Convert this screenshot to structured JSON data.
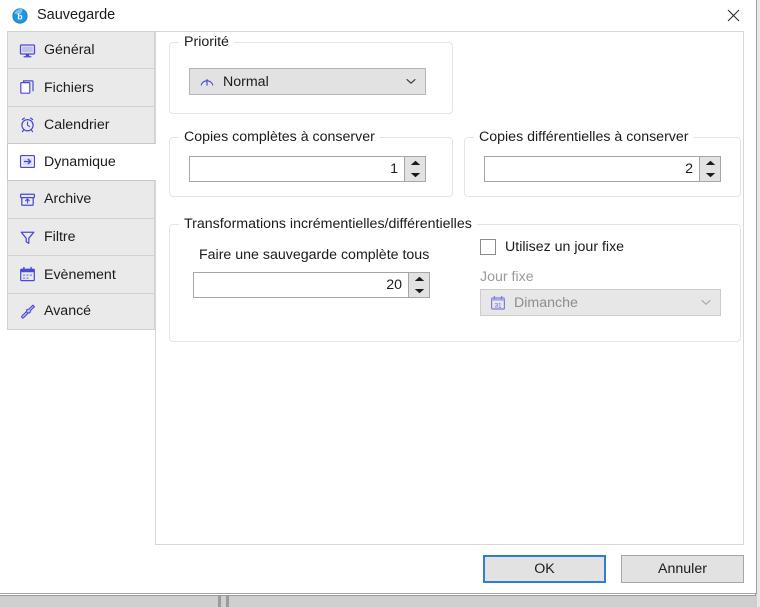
{
  "window": {
    "title": "Sauvegarde",
    "icon": "backup-disc-icon",
    "close_label": "×"
  },
  "sidebar": {
    "items": [
      {
        "label": "Général",
        "icon": "monitor-icon",
        "selected": false
      },
      {
        "label": "Fichiers",
        "icon": "files-icon",
        "selected": false
      },
      {
        "label": "Calendrier",
        "icon": "alarm-clock-icon",
        "selected": false
      },
      {
        "label": "Dynamique",
        "icon": "arrow-in-box-icon",
        "selected": true
      },
      {
        "label": "Archive",
        "icon": "archive-box-icon",
        "selected": false
      },
      {
        "label": "Filtre",
        "icon": "funnel-icon",
        "selected": false
      },
      {
        "label": "Evènement",
        "icon": "calendar-icon",
        "selected": false
      },
      {
        "label": "Avancé",
        "icon": "wrench-icon",
        "selected": false
      }
    ]
  },
  "main": {
    "priority_group": {
      "legend": "Priorité",
      "combo": {
        "value": "Normal",
        "icon": "gauge-icon",
        "arrow": "⌄"
      }
    },
    "full_copies_group": {
      "legend": "Copies complètes à conserver",
      "spinner_value": "1"
    },
    "diff_copies_group": {
      "legend": "Copies différentielles à conserver",
      "spinner_value": "2"
    },
    "transformations_group": {
      "legend": "Transformations incrémentielles/différentielles",
      "full_backup_label": "Faire une sauvegarde complète tous",
      "full_backup_value": "20",
      "fixed_day_checkbox_label": "Utilisez un jour fixe",
      "fixed_day_checked": false,
      "fixed_day_label": "Jour fixe",
      "fixed_day_combo": {
        "value": "Dimanche",
        "icon": "calendar-31-icon",
        "arrow": "⌄",
        "disabled": true
      }
    }
  },
  "footer": {
    "ok_label": "OK",
    "cancel_label": "Annuler"
  },
  "colors": {
    "accent": "#2f7fd0",
    "icon_blue": "#4a4ad6",
    "group_border": "#dce6ef",
    "nav_bg": "#eaeaea"
  }
}
